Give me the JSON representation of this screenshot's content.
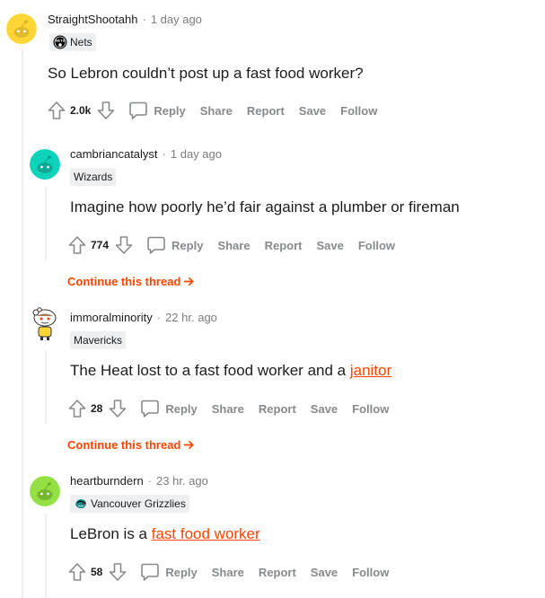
{
  "comments": [
    {
      "username": "StraightShootahh",
      "time": "1 day ago",
      "flair": "Nets",
      "body": "So Lebron couldn’t post up a fast food worker?",
      "score": "2.0k"
    },
    {
      "username": "cambriancatalyst",
      "time": "1 day ago",
      "flair": "Wizards",
      "body": "Imagine how poorly he’d fair against a plumber or fireman",
      "score": "774"
    },
    {
      "username": "immoralminority",
      "time": "22 hr. ago",
      "flair": "Mavericks",
      "body_prefix": "The Heat lost to a fast food worker and a ",
      "body_link": "janitor",
      "score": "28"
    },
    {
      "username": "heartburndern",
      "time": "23 hr. ago",
      "flair": "Vancouver Grizzlies",
      "body_prefix": "LeBron is a ",
      "body_link": "fast food worker",
      "score": "58"
    }
  ],
  "actions": {
    "reply": "Reply",
    "share": "Share",
    "report": "Report",
    "save": "Save",
    "follow": "Follow"
  },
  "continue_thread": "Continue this thread",
  "separator": "·",
  "colors": {
    "accent": "#ff4500",
    "avatar_yellow": "#ffd635",
    "avatar_teal": "#0dd3bb",
    "avatar_green": "#94e044",
    "flair_bg": "#edeff1",
    "meta_gray": "#7c7c7c"
  },
  "icons": {
    "upvote": "upvote-arrow-icon",
    "downvote": "downvote-arrow-icon",
    "reply": "speech-bubble-icon",
    "continue": "arrow-right-icon",
    "nets_flair": "nets-logo-icon",
    "grizzlies_flair": "grizzlies-logo-icon"
  }
}
